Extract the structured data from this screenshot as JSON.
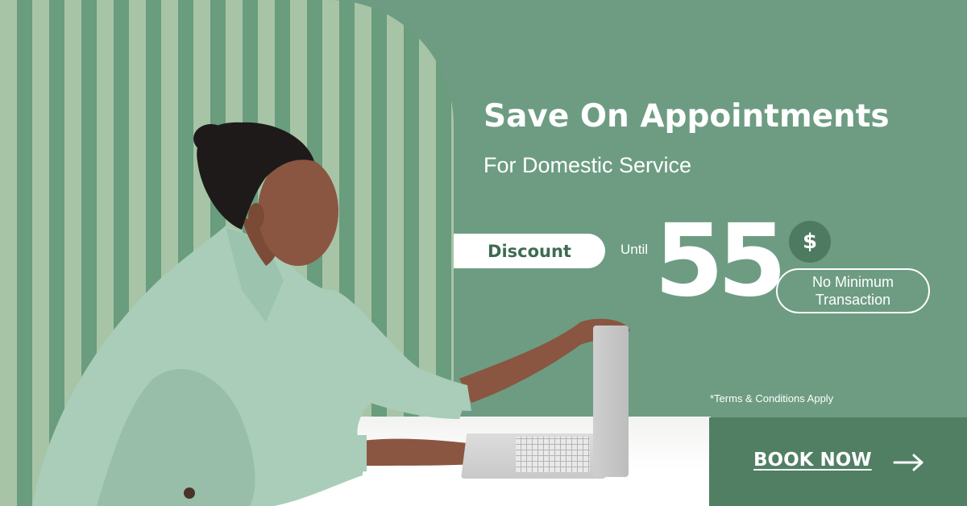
{
  "banner": {
    "headline": "Save On Appointments",
    "subheadline": "For Domestic Service",
    "discount_label": "Discount",
    "until_label": "Until",
    "amount": "55",
    "currency_symbol": "$",
    "min_line1": "No Minimum",
    "min_line2": "Transaction",
    "terms": "*Terms & Conditions Apply",
    "cta_label": "BOOK NOW",
    "cta_icon": "arrow-right-icon"
  },
  "colors": {
    "background": "#6d9c82",
    "stripe_light": "#a8c4a6",
    "stripe_dark": "#6a9c7e",
    "cta_background": "#507f64",
    "dollar_circle": "#4e7a61",
    "discount_text": "#3e6b52",
    "text": "#ffffff"
  }
}
